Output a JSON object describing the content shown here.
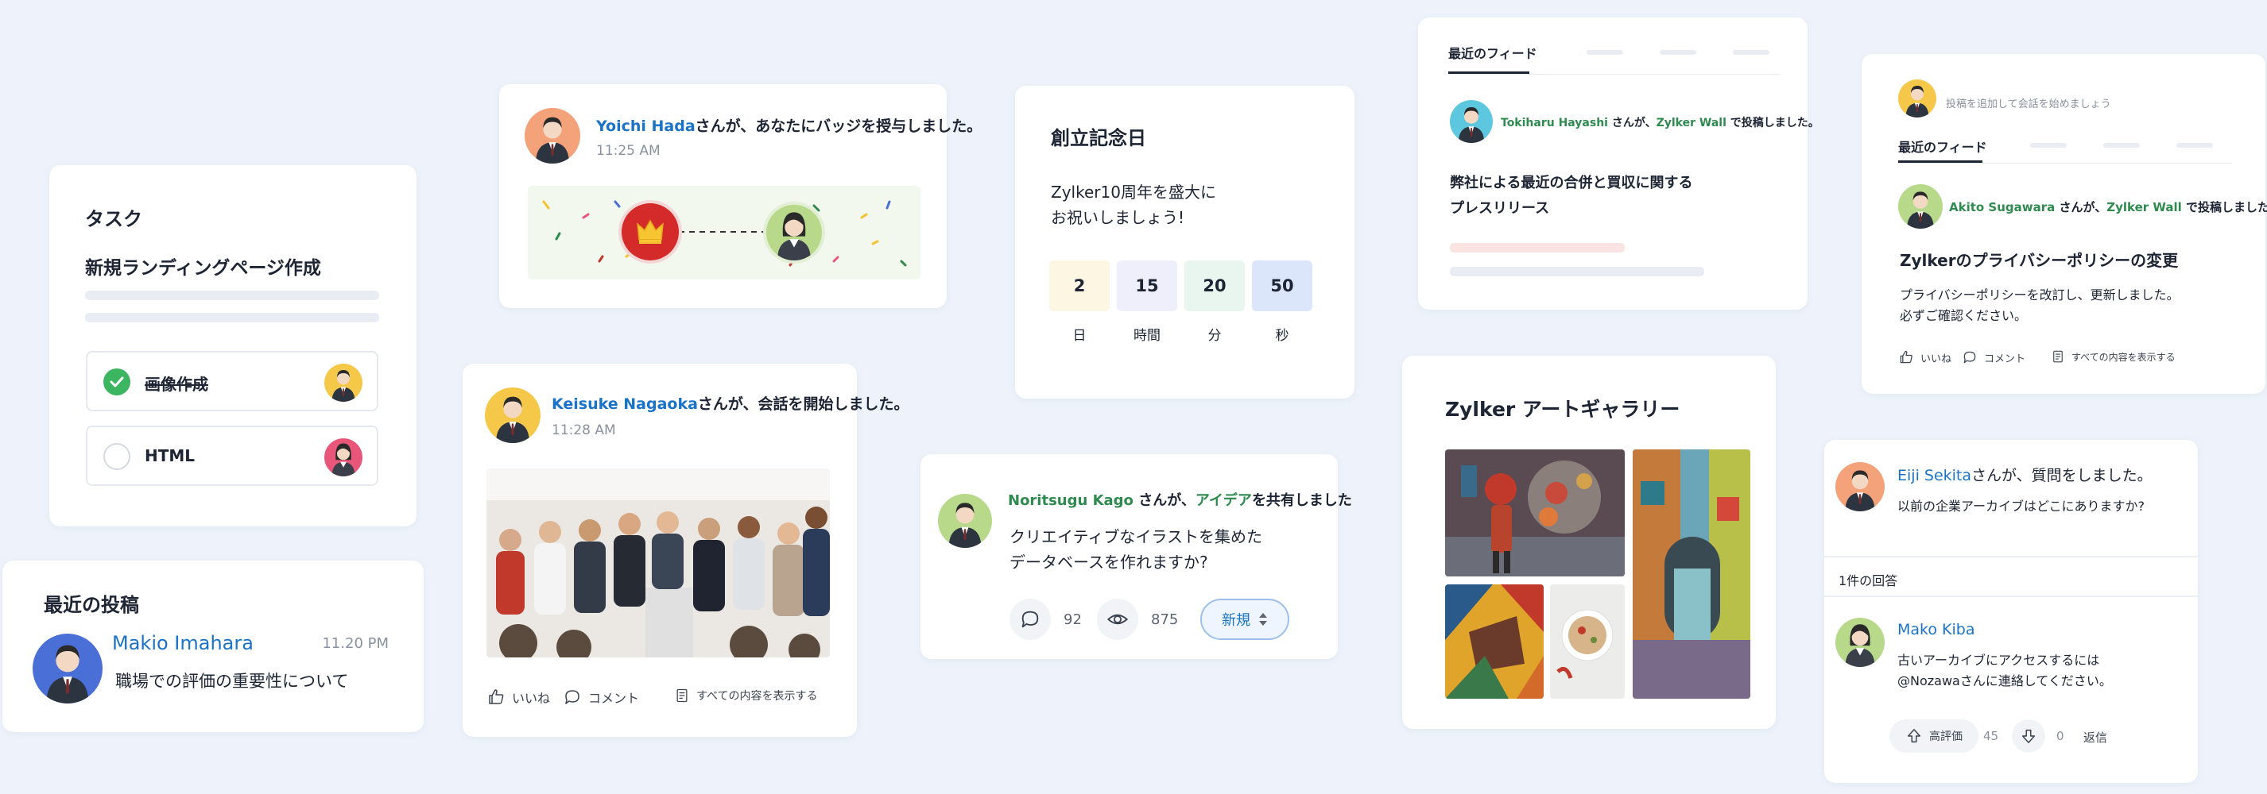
{
  "task": {
    "title": "タスク",
    "subtitle": "新規ランディングページ作成",
    "items": [
      {
        "label": "画像作成",
        "done": true
      },
      {
        "label": "HTML",
        "done": false
      }
    ]
  },
  "recent_posts": {
    "title": "最近の投稿",
    "author": "Makio Imahara",
    "time": "11.20 PM",
    "text": "職場での評価の重要性について"
  },
  "badge": {
    "name": "Yoichi Hada",
    "text": "さんが、あなたにバッジを授与しました。",
    "time": "11:25 AM"
  },
  "conversation": {
    "name": "Keisuke Nagaoka",
    "text": "さんが、会話を開始しました。",
    "time": "11:28 AM",
    "actions": {
      "like": "いいね",
      "comment": "コメント",
      "view_all": "すべての内容を表示する"
    }
  },
  "anniversary": {
    "title": "創立記念日",
    "line1": "Zylker10周年を盛大に",
    "line2": "お祝いしましょう!",
    "countdown": [
      {
        "value": "2",
        "unit": "日",
        "color": "#fdf6e3"
      },
      {
        "value": "15",
        "unit": "時間",
        "color": "#efeffb"
      },
      {
        "value": "20",
        "unit": "分",
        "color": "#e8f6ef"
      },
      {
        "value": "50",
        "unit": "秒",
        "color": "#dce6fb"
      }
    ]
  },
  "idea": {
    "name": "Noritsugu Kago",
    "mid": " さんが、",
    "link": "アイデア",
    "tail": "を共有しました",
    "line1": "クリエイティブなイラストを集めた",
    "line2": "データベースを作れますか?",
    "comments": "92",
    "views": "875",
    "status": "新規"
  },
  "feed1": {
    "tab": "最近のフィード",
    "name": "Tokiharu Hayashi",
    "mid": " さんが、",
    "link": "Zylker Wall",
    "tail": " で投稿しました。",
    "line1": "弊社による最近の合併と買収に関する",
    "line2": "プレスリリース"
  },
  "gallery": {
    "title": "Zylker アートギャラリー"
  },
  "feed2": {
    "placeholder": "投稿を追加して会話を始めましょう",
    "tab": "最近のフィード",
    "name": "Akito Sugawara",
    "mid": " さんが、",
    "link": "Zylker Wall",
    "tail": " で投稿しました。",
    "title": "Zylkerのプライバシーポリシーの変更",
    "line1": "プライバシーポリシーを改訂し、更新しました。",
    "line2": "必ずご確認ください。",
    "actions": {
      "like": "いいね",
      "comment": "コメント",
      "view_all": "すべての内容を表示する"
    }
  },
  "question": {
    "name": "Eiji Sekita",
    "text": "さんが、質問をしました。",
    "body": "以前の企業アーカイブはどこにありますか?",
    "answers": "1件の回答",
    "answer_name": "Mako Kiba",
    "answer_line1": "古いアーカイブにアクセスするには",
    "answer_line2": "@Nozawaさんに連絡してください。",
    "upvote": "高評価",
    "upvotes": "45",
    "downvotes": "0",
    "reply": "返信"
  }
}
